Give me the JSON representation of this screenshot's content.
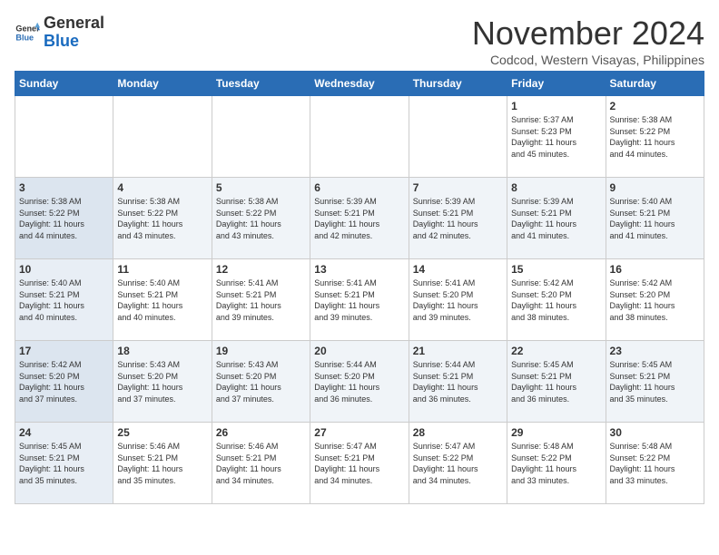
{
  "logo": {
    "line1": "General",
    "line2": "Blue"
  },
  "title": "November 2024",
  "location": "Codcod, Western Visayas, Philippines",
  "days_of_week": [
    "Sunday",
    "Monday",
    "Tuesday",
    "Wednesday",
    "Thursday",
    "Friday",
    "Saturday"
  ],
  "weeks": [
    [
      {
        "day": "",
        "info": ""
      },
      {
        "day": "",
        "info": ""
      },
      {
        "day": "",
        "info": ""
      },
      {
        "day": "",
        "info": ""
      },
      {
        "day": "",
        "info": ""
      },
      {
        "day": "1",
        "info": "Sunrise: 5:37 AM\nSunset: 5:23 PM\nDaylight: 11 hours\nand 45 minutes."
      },
      {
        "day": "2",
        "info": "Sunrise: 5:38 AM\nSunset: 5:22 PM\nDaylight: 11 hours\nand 44 minutes."
      }
    ],
    [
      {
        "day": "3",
        "info": "Sunrise: 5:38 AM\nSunset: 5:22 PM\nDaylight: 11 hours\nand 44 minutes."
      },
      {
        "day": "4",
        "info": "Sunrise: 5:38 AM\nSunset: 5:22 PM\nDaylight: 11 hours\nand 43 minutes."
      },
      {
        "day": "5",
        "info": "Sunrise: 5:38 AM\nSunset: 5:22 PM\nDaylight: 11 hours\nand 43 minutes."
      },
      {
        "day": "6",
        "info": "Sunrise: 5:39 AM\nSunset: 5:21 PM\nDaylight: 11 hours\nand 42 minutes."
      },
      {
        "day": "7",
        "info": "Sunrise: 5:39 AM\nSunset: 5:21 PM\nDaylight: 11 hours\nand 42 minutes."
      },
      {
        "day": "8",
        "info": "Sunrise: 5:39 AM\nSunset: 5:21 PM\nDaylight: 11 hours\nand 41 minutes."
      },
      {
        "day": "9",
        "info": "Sunrise: 5:40 AM\nSunset: 5:21 PM\nDaylight: 11 hours\nand 41 minutes."
      }
    ],
    [
      {
        "day": "10",
        "info": "Sunrise: 5:40 AM\nSunset: 5:21 PM\nDaylight: 11 hours\nand 40 minutes."
      },
      {
        "day": "11",
        "info": "Sunrise: 5:40 AM\nSunset: 5:21 PM\nDaylight: 11 hours\nand 40 minutes."
      },
      {
        "day": "12",
        "info": "Sunrise: 5:41 AM\nSunset: 5:21 PM\nDaylight: 11 hours\nand 39 minutes."
      },
      {
        "day": "13",
        "info": "Sunrise: 5:41 AM\nSunset: 5:21 PM\nDaylight: 11 hours\nand 39 minutes."
      },
      {
        "day": "14",
        "info": "Sunrise: 5:41 AM\nSunset: 5:20 PM\nDaylight: 11 hours\nand 39 minutes."
      },
      {
        "day": "15",
        "info": "Sunrise: 5:42 AM\nSunset: 5:20 PM\nDaylight: 11 hours\nand 38 minutes."
      },
      {
        "day": "16",
        "info": "Sunrise: 5:42 AM\nSunset: 5:20 PM\nDaylight: 11 hours\nand 38 minutes."
      }
    ],
    [
      {
        "day": "17",
        "info": "Sunrise: 5:42 AM\nSunset: 5:20 PM\nDaylight: 11 hours\nand 37 minutes."
      },
      {
        "day": "18",
        "info": "Sunrise: 5:43 AM\nSunset: 5:20 PM\nDaylight: 11 hours\nand 37 minutes."
      },
      {
        "day": "19",
        "info": "Sunrise: 5:43 AM\nSunset: 5:20 PM\nDaylight: 11 hours\nand 37 minutes."
      },
      {
        "day": "20",
        "info": "Sunrise: 5:44 AM\nSunset: 5:20 PM\nDaylight: 11 hours\nand 36 minutes."
      },
      {
        "day": "21",
        "info": "Sunrise: 5:44 AM\nSunset: 5:21 PM\nDaylight: 11 hours\nand 36 minutes."
      },
      {
        "day": "22",
        "info": "Sunrise: 5:45 AM\nSunset: 5:21 PM\nDaylight: 11 hours\nand 36 minutes."
      },
      {
        "day": "23",
        "info": "Sunrise: 5:45 AM\nSunset: 5:21 PM\nDaylight: 11 hours\nand 35 minutes."
      }
    ],
    [
      {
        "day": "24",
        "info": "Sunrise: 5:45 AM\nSunset: 5:21 PM\nDaylight: 11 hours\nand 35 minutes."
      },
      {
        "day": "25",
        "info": "Sunrise: 5:46 AM\nSunset: 5:21 PM\nDaylight: 11 hours\nand 35 minutes."
      },
      {
        "day": "26",
        "info": "Sunrise: 5:46 AM\nSunset: 5:21 PM\nDaylight: 11 hours\nand 34 minutes."
      },
      {
        "day": "27",
        "info": "Sunrise: 5:47 AM\nSunset: 5:21 PM\nDaylight: 11 hours\nand 34 minutes."
      },
      {
        "day": "28",
        "info": "Sunrise: 5:47 AM\nSunset: 5:22 PM\nDaylight: 11 hours\nand 34 minutes."
      },
      {
        "day": "29",
        "info": "Sunrise: 5:48 AM\nSunset: 5:22 PM\nDaylight: 11 hours\nand 33 minutes."
      },
      {
        "day": "30",
        "info": "Sunrise: 5:48 AM\nSunset: 5:22 PM\nDaylight: 11 hours\nand 33 minutes."
      }
    ]
  ]
}
